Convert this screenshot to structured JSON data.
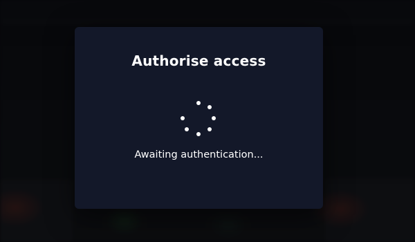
{
  "modal": {
    "title": "Authorise access",
    "status_text": "Awaiting authentication...",
    "spinner_icon": "loading-spinner-icon"
  },
  "colors": {
    "modal_background": "#131829",
    "text": "#ffffff",
    "page_background": "#0b0d12"
  }
}
